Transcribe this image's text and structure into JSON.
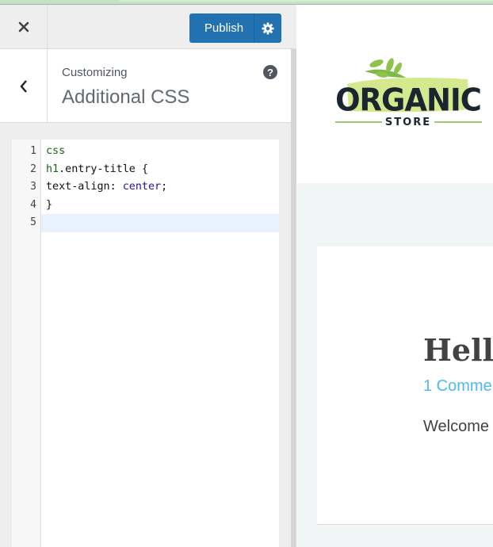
{
  "sidebar": {
    "close_label": "Close",
    "publish_label": "Publish",
    "settings_label": "Publish settings",
    "back_label": "Back",
    "customizing_label": "Customizing",
    "section_title": "Additional CSS",
    "help_glyph": "?"
  },
  "editor": {
    "lines": [
      {
        "number": "1",
        "text": "css"
      },
      {
        "number": "2",
        "selector": "h1",
        "rest": ".entry-title {"
      },
      {
        "number": "3",
        "property": "text-align: ",
        "value": "center",
        "end": ";"
      },
      {
        "number": "4",
        "text": "}"
      },
      {
        "number": "5",
        "text": ""
      }
    ],
    "active_line": 5
  },
  "preview": {
    "logo": {
      "word": "ORGANIC",
      "sub": "STORE"
    },
    "post": {
      "title": "Hello",
      "comments": "1 Comme",
      "excerpt": "Welcome"
    }
  },
  "colors": {
    "accent": "#2271b1",
    "link": "#4fb9ee",
    "logo_green": "#cde57a",
    "logo_dark": "#1a2530"
  }
}
